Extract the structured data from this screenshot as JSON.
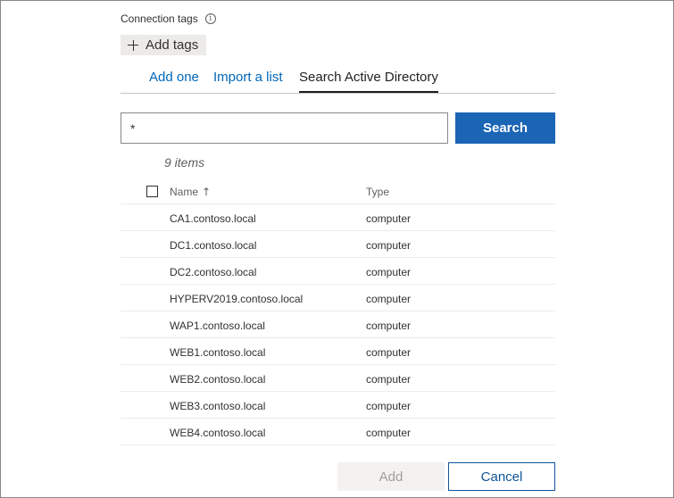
{
  "connection_tags": {
    "label": "Connection tags",
    "info_glyph": "i",
    "add_tags_label": "Add tags"
  },
  "tabs": [
    {
      "label": "Add one",
      "active": false
    },
    {
      "label": "Import a list",
      "active": false
    },
    {
      "label": "Search Active Directory",
      "active": true
    }
  ],
  "search": {
    "value": "*",
    "button_label": "Search"
  },
  "results": {
    "count_text": "9 items",
    "columns": {
      "name": "Name",
      "type": "Type",
      "sort": "ascending"
    },
    "rows": [
      {
        "name": "CA1.contoso.local",
        "type": "computer"
      },
      {
        "name": "DC1.contoso.local",
        "type": "computer"
      },
      {
        "name": "DC2.contoso.local",
        "type": "computer"
      },
      {
        "name": "HYPERV2019.contoso.local",
        "type": "computer"
      },
      {
        "name": "WAP1.contoso.local",
        "type": "computer"
      },
      {
        "name": "WEB1.contoso.local",
        "type": "computer"
      },
      {
        "name": "WEB2.contoso.local",
        "type": "computer"
      },
      {
        "name": "WEB3.contoso.local",
        "type": "computer"
      },
      {
        "name": "WEB4.contoso.local",
        "type": "computer"
      }
    ]
  },
  "footer": {
    "add_label": "Add",
    "add_enabled": false,
    "cancel_label": "Cancel"
  },
  "colors": {
    "accent": "#1b65b5",
    "link": "#0067b8",
    "cancel_border": "#0f5597"
  }
}
